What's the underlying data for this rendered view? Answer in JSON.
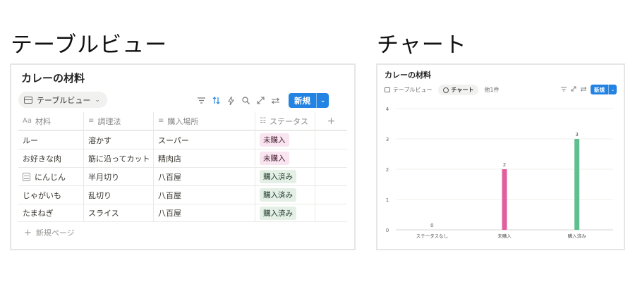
{
  "headings": {
    "left": "テーブルビュー",
    "right": "チャート"
  },
  "table_panel": {
    "title": "カレーの材料",
    "view_pill": {
      "label": "テーブルビュー",
      "icon": "table-icon"
    },
    "toolbar": {
      "icons": [
        "filter-icon",
        "sort-icon",
        "lightning-icon",
        "search-icon",
        "expand-icon",
        "settings-icon"
      ],
      "new_label": "新規"
    },
    "columns": [
      {
        "icon": "Aa",
        "label": "材料"
      },
      {
        "icon": "≡",
        "label": "調理法"
      },
      {
        "icon": "≡",
        "label": "購入場所"
      },
      {
        "icon": "☷",
        "label": "ステータス"
      }
    ],
    "add_column_label": "+",
    "rows": [
      {
        "name": "ルー",
        "method": "溶かす",
        "place": "スーパー",
        "status": "未購入",
        "page_icon": false
      },
      {
        "name": "お好きな肉",
        "method": "筋に沿ってカット",
        "place": "精肉店",
        "status": "未購入",
        "page_icon": false
      },
      {
        "name": "にんじん",
        "method": "半月切り",
        "place": "八百屋",
        "status": "購入済み",
        "page_icon": true
      },
      {
        "name": "じゃがいも",
        "method": "乱切り",
        "place": "八百屋",
        "status": "購入済み",
        "page_icon": false
      },
      {
        "name": "たまねぎ",
        "method": "スライス",
        "place": "八百屋",
        "status": "購入済み",
        "page_icon": false
      }
    ],
    "status_colors": {
      "未購入": {
        "bg": "#f9e5ef",
        "fg": "#4c2337"
      },
      "購入済み": {
        "bg": "#e4efe6",
        "fg": "#1c3829"
      }
    },
    "new_page_label": "新規ページ"
  },
  "chart_panel": {
    "title": "カレーの材料",
    "views": {
      "table": "テーブルビュー",
      "chart": "チャート",
      "more": "他1件"
    },
    "new_label": "新規",
    "accent": "#2383e2"
  },
  "chart_data": {
    "type": "bar",
    "categories": [
      "ステータスなし",
      "未購入",
      "購入済み"
    ],
    "values": [
      0,
      2,
      3
    ],
    "colors": [
      "#9b9a97",
      "#e0609f",
      "#5fbf8f"
    ],
    "ylim": [
      0,
      4
    ],
    "yticks": [
      0,
      1,
      2,
      3,
      4
    ],
    "grid": true,
    "data_labels": true
  }
}
